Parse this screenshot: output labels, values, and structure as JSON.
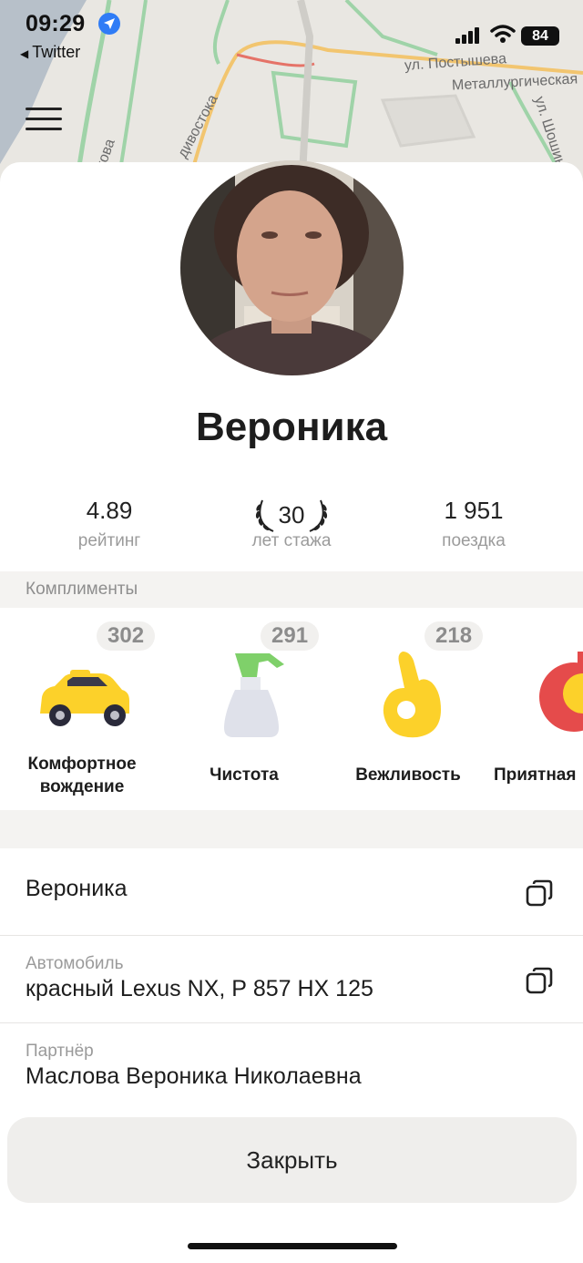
{
  "status_bar": {
    "time": "09:29",
    "back_app": "Twitter",
    "battery": "84"
  },
  "map": {
    "street_labels": [
      "ул. Постышева",
      "Металлургическая",
      "ул. Шошина",
      "дивостока",
      "кова"
    ]
  },
  "driver": {
    "name": "Вероника"
  },
  "stats": [
    {
      "value": "4.89",
      "label": "рейтинг"
    },
    {
      "value": "30",
      "label": "лет стажа"
    },
    {
      "value": "1 951",
      "label": "поездка"
    }
  ],
  "compliments": {
    "title": "Комплименты",
    "items": [
      {
        "count": "302",
        "label": "Комфортное вождение",
        "icon": "taxi-car-icon"
      },
      {
        "count": "291",
        "label": "Чистота",
        "icon": "spray-bottle-icon"
      },
      {
        "count": "218",
        "label": "Вежливость",
        "icon": "ok-hand-icon"
      },
      {
        "count": "",
        "label": "Приятная",
        "icon": "music-icon"
      }
    ]
  },
  "info_rows": [
    {
      "sub": "",
      "value": "Вероника",
      "copy": true
    },
    {
      "sub": "Автомобиль",
      "value": "красный Lexus NX, Р 857 НХ 125",
      "copy": true
    },
    {
      "sub": "Партнёр",
      "value": "Маслова Вероника Николаевна",
      "copy": false
    }
  ],
  "close_button": "Закрыть",
  "colors": {
    "accent_yellow": "#fcd12a",
    "location_blue": "#2f7cf6",
    "section_bg": "#f4f3f1"
  }
}
